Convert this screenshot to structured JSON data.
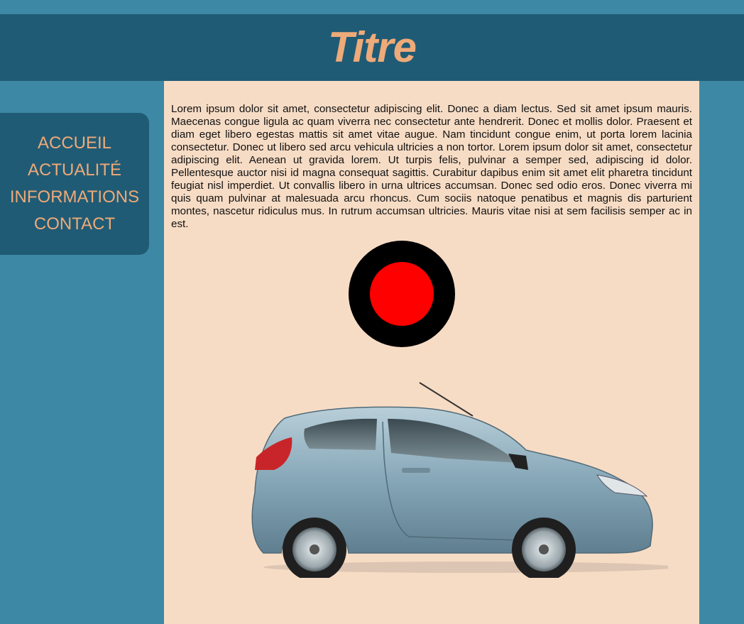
{
  "header": {
    "title": "Titre"
  },
  "nav": {
    "items": [
      {
        "label": "ACCUEIL"
      },
      {
        "label": "ACTUALITÉ"
      },
      {
        "label": "INFORMATIONS"
      },
      {
        "label": "CONTACT"
      }
    ]
  },
  "main": {
    "paragraph": "Lorem ipsum dolor sit amet, consectetur adipiscing elit. Donec a diam lectus. Sed sit amet ipsum mauris. Maecenas congue ligula ac quam viverra nec consectetur ante hendrerit. Donec et mollis dolor. Praesent et diam eget libero egestas mattis sit amet vitae augue. Nam tincidunt congue enim, ut porta lorem lacinia consectetur. Donec ut libero sed arcu vehicula ultricies a non tortor. Lorem ipsum dolor sit amet, consectetur adipiscing elit. Aenean ut gravida lorem. Ut turpis felis, pulvinar a semper sed, adipiscing id dolor. Pellentesque auctor nisi id magna consequat sagittis. Curabitur dapibus enim sit amet elit pharetra tincidunt feugiat nisl imperdiet. Ut convallis libero in urna ultrices accumsan. Donec sed odio eros. Donec viverra mi quis quam pulvinar at malesuada arcu rhoncus. Cum sociis natoque penatibus et magnis dis parturient montes, nascetur ridiculus mus. In rutrum accumsan ultricies. Mauris vitae nisi at sem facilisis semper ac in est."
  },
  "colors": {
    "page_background": "#3d88a4",
    "header_background": "#205b75",
    "accent_text": "#eeaa78",
    "content_background": "#f7dcc5",
    "circle_outer": "#000000",
    "circle_inner": "#ff0000",
    "car_body": "#8fb0c0"
  },
  "images": {
    "circle": "black-circle-with-red-center",
    "car": "blue-hatchback-car-photo"
  }
}
